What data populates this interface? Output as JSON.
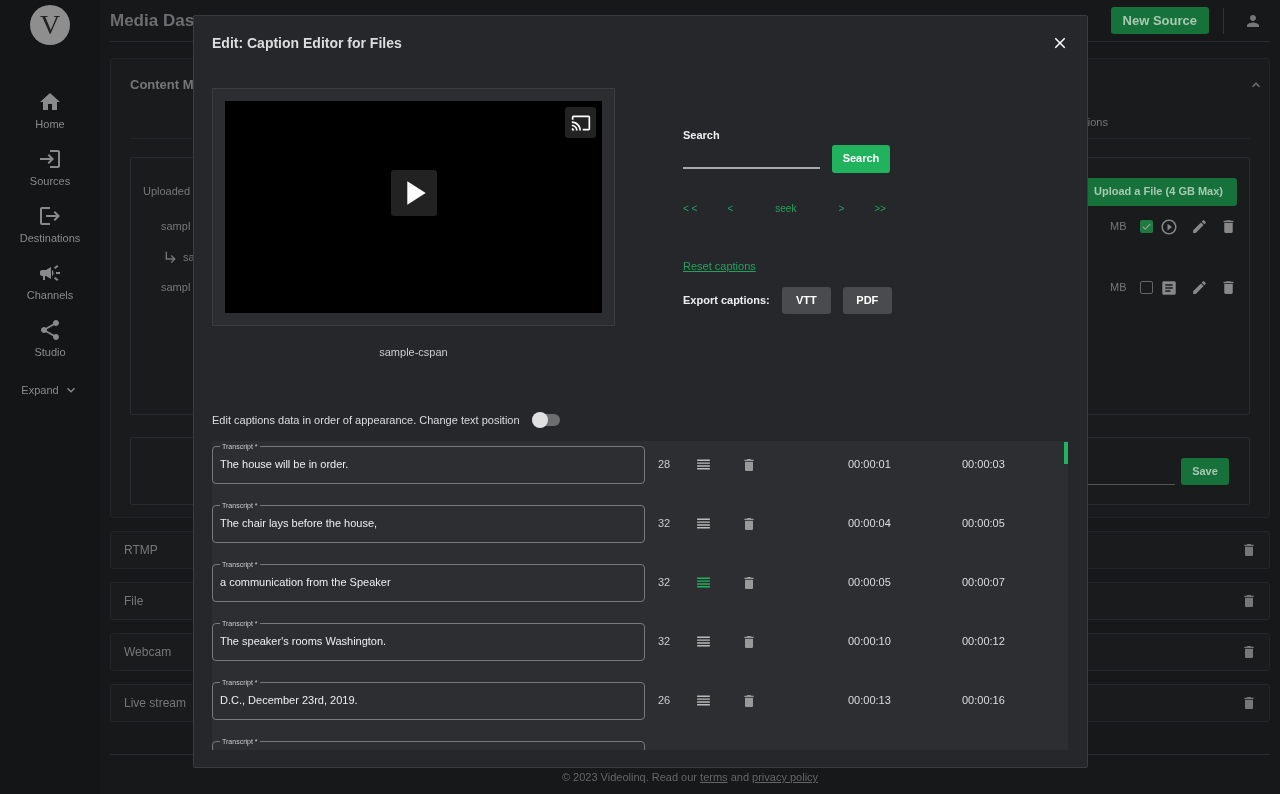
{
  "sidebar": {
    "logo": "V",
    "items": [
      {
        "label": "Home",
        "kind": "home"
      },
      {
        "label": "Sources",
        "kind": "sources"
      },
      {
        "label": "Destinations",
        "kind": "destinations"
      },
      {
        "label": "Channels",
        "kind": "channels"
      },
      {
        "label": "Studio",
        "kind": "studio"
      }
    ],
    "expand": "Expand"
  },
  "header": {
    "title": "Media Das",
    "new_source": "New Source"
  },
  "content_card": {
    "title": "Content M",
    "tab_fragment": "ions",
    "uploaded": "Uploaded",
    "upload_button": "Upload a File (4 GB Max)",
    "files": [
      {
        "kind": "video",
        "name": "sampl",
        "size": "MB",
        "checked": true
      },
      {
        "kind": "child",
        "name": "sa"
      },
      {
        "kind": "document",
        "name": "sampl",
        "size": "MB",
        "checked": false
      }
    ],
    "save_button": "Save"
  },
  "source_types": [
    "RTMP",
    "File",
    "Webcam",
    "Live stream"
  ],
  "footer": {
    "text": "© 2023 Videolinq. Read our",
    "terms": "terms",
    "and": "and",
    "privacy": "privacy policy"
  },
  "modal": {
    "title": "Edit: Caption Editor for Files",
    "video": {
      "caption": "sample-cspan"
    },
    "search": {
      "label": "Search",
      "button": "Search"
    },
    "nav": [
      "< <",
      "<",
      "seek",
      ">",
      ">>"
    ],
    "reset": "Reset captions",
    "export": {
      "label": "Export captions:",
      "buttons": [
        "VTT",
        "PDF"
      ]
    },
    "toggle": {
      "label": "Edit captions data in order of appearance. Change text position",
      "on": false
    },
    "captions": [
      {
        "label": "Transcript *",
        "text": "The house will be in order.",
        "count": "28",
        "active": false,
        "start": "00:00:01",
        "end": "00:00:03"
      },
      {
        "label": "Transcript *",
        "text": "The chair lays before the house,",
        "count": "32",
        "active": false,
        "start": "00:00:04",
        "end": "00:00:05"
      },
      {
        "label": "Transcript *",
        "text": "a communication from the Speaker",
        "count": "32",
        "active": true,
        "start": "00:00:05",
        "end": "00:00:07"
      },
      {
        "label": "Transcript *",
        "text": "The speaker's rooms Washington.",
        "count": "32",
        "active": false,
        "start": "00:00:10",
        "end": "00:00:12"
      },
      {
        "label": "Transcript *",
        "text": "D.C., December 23rd, 2019.",
        "count": "26",
        "active": false,
        "start": "00:00:13",
        "end": "00:00:16"
      },
      {
        "label": "Transcript *"
      }
    ]
  }
}
